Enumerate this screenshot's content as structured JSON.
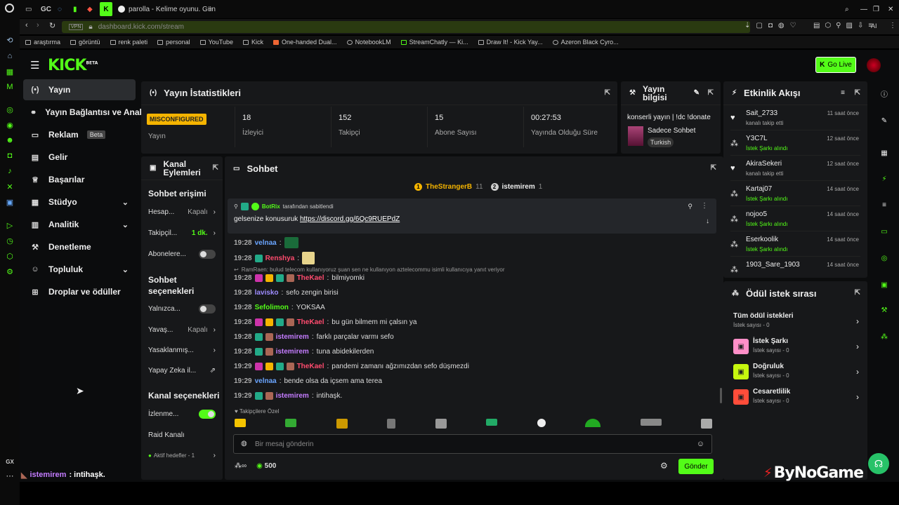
{
  "browser": {
    "tabs": [
      {
        "label": "GC"
      },
      {
        "label": "parolla - Kelime oyunu. Gün"
      }
    ],
    "new_tab": "+",
    "vpn": "VPN",
    "url": "dashboard.kick.com/stream",
    "ai": "AI",
    "bookmarks": [
      "araştırma",
      "görüntü",
      "renk paleti",
      "personal",
      "YouTube",
      "Kick",
      "One-handed Dual...",
      "NotebookLM",
      "StreamChatly — Ki...",
      "Draw It! - Kick Yay...",
      "Azeron Black Cyro..."
    ],
    "opera_gx": "GX"
  },
  "app": {
    "logo": "KICK",
    "logo_sup": "BETA",
    "go_live": "Go Live"
  },
  "nav": [
    {
      "label": "Yayın",
      "icon": "(•)",
      "active": true
    },
    {
      "label": "Yayın Bağlantısı ve Anahtar",
      "icon": "⚭"
    },
    {
      "label": "Reklam",
      "icon": "▭",
      "badge": "Beta"
    },
    {
      "label": "Gelir",
      "icon": "▤"
    },
    {
      "label": "Başarılar",
      "icon": "♕"
    },
    {
      "label": "Stüdyo",
      "icon": "▦",
      "chev": "⌄"
    },
    {
      "label": "Analitik",
      "icon": "▥",
      "chev": "⌄"
    },
    {
      "label": "Denetleme",
      "icon": "⚒"
    },
    {
      "label": "Topluluk",
      "icon": "☺",
      "chev": "⌄"
    },
    {
      "label": "Droplar ve ödüller",
      "icon": "⊞"
    }
  ],
  "stats": {
    "title": "Yayın İstatistikleri",
    "status_badge": "MISCONFIGURED",
    "status_label": "Yayın",
    "items": [
      {
        "value": "18",
        "label": "İzleyici"
      },
      {
        "value": "152",
        "label": "Takipçi"
      },
      {
        "value": "15",
        "label": "Abone Sayısı"
      },
      {
        "value": "00:27:53",
        "label": "Yayında Olduğu Süre"
      }
    ]
  },
  "info": {
    "title": "Yayın bilgisi",
    "stream_title": "konserli yayın | !dc !donate",
    "category": "Sadece Sohbet",
    "language": "Turkish"
  },
  "actions": {
    "title": "Kanal Eylemleri",
    "chat_access": "Sohbet erişimi",
    "rows1": [
      {
        "label": "Hesap...",
        "value": "Kapalı"
      },
      {
        "label": "Takipçil...",
        "value": "1 dk."
      },
      {
        "label": "Abonelere..."
      }
    ],
    "chat_options": "Sohbet seçenekleri",
    "rows2": [
      {
        "label": "Yalnızca..."
      },
      {
        "label": "Yavaş...",
        "value": "Kapalı"
      },
      {
        "label": "Yasaklanmış..."
      },
      {
        "label": "Yapay Zeka il..."
      }
    ],
    "channel_options": "Kanal seçenekleri",
    "rows3": [
      {
        "label": "İzlenme..."
      },
      {
        "label": "Raid Kanalı"
      },
      {
        "label": "Aktif hedefler - 1"
      }
    ]
  },
  "chat": {
    "title": "Sohbet",
    "top_chatters": [
      {
        "rank": "1",
        "name": "TheStrangerB",
        "count": "11"
      },
      {
        "rank": "2",
        "name": "istemirem",
        "count": "1"
      }
    ],
    "pinned_by": "BotRix",
    "pinned_suffix": "tarafından sabitlendi",
    "pinned_text": "gelsenize konusuruk",
    "pinned_link": "https://discord.gg/6Qc9RUEPdZ",
    "reply_note": "RamRaen: bulud telecom kullanıyoruz şuan sen ne kullanıyon aztelecommu isimli kullanıcıya yanıt veriyor",
    "messages": [
      {
        "time": "19:28",
        "user": "velnaa",
        "color": "#6aa5ff",
        "text": ""
      },
      {
        "time": "19:28",
        "user": "Renshya",
        "color": "#ff4b6e",
        "text": ""
      },
      {
        "time": "19:28",
        "user": "TheKael",
        "color": "#ff4b6e",
        "text": "bilmiyomki"
      },
      {
        "time": "19:28",
        "user": "lavisko",
        "color": "#9e8cff",
        "text": "sefo zengin birisi"
      },
      {
        "time": "19:28",
        "user": "Sefolimon",
        "color": "#53fc18",
        "text": "YOKSAA"
      },
      {
        "time": "19:28",
        "user": "TheKael",
        "color": "#ff4b6e",
        "text": "bu gün bilmem mi çalsın ya"
      },
      {
        "time": "19:28",
        "user": "istemirem",
        "color": "#c47cff",
        "text": "farklı parçalar varmı sefo"
      },
      {
        "time": "19:28",
        "user": "istemirem",
        "color": "#c47cff",
        "text": "tuna abidekilerden"
      },
      {
        "time": "19:29",
        "user": "TheKael",
        "color": "#ff4b6e",
        "text": "pandemi zamanı ağzımızdan sefo düşmezdi"
      },
      {
        "time": "19:29",
        "user": "velnaa",
        "color": "#6aa5ff",
        "text": "bende olsa da içsem ama terea"
      },
      {
        "time": "19:29",
        "user": "istemirem",
        "color": "#c47cff",
        "text": "intihaşk."
      }
    ],
    "followers_only": "Takipçilere Özel",
    "input_placeholder": "Bir mesaj gönderin",
    "points": "500",
    "send": "Gönder"
  },
  "events": {
    "title": "Etkinlik Akışı",
    "items": [
      {
        "icon": "♥",
        "name": "Sait_2733",
        "desc": "kanalı takip etti",
        "time": "11 saat önce"
      },
      {
        "icon": "⁂",
        "name": "Y3C7L",
        "desc": "İstek Şarkı alındı",
        "time": "12 saat önce"
      },
      {
        "icon": "♥",
        "name": "AkiraSekeri",
        "desc": "kanalı takip etti",
        "time": "12 saat önce"
      },
      {
        "icon": "⁂",
        "name": "Kartaj07",
        "desc": "İstek Şarkı alındı",
        "time": "14 saat önce"
      },
      {
        "icon": "⁂",
        "name": "nojoo5",
        "desc": "İstek Şarkı alındı",
        "time": "14 saat önce"
      },
      {
        "icon": "⁂",
        "name": "Eserkoolik",
        "desc": "İstek Şarkı alındı",
        "time": "14 saat önce"
      },
      {
        "icon": "⁂",
        "name": "1903_Sare_1903",
        "desc": "",
        "time": "14 saat önce"
      }
    ]
  },
  "rewards": {
    "title": "Ödül istek sırası",
    "items": [
      {
        "name": "Tüm ödül istekleri",
        "desc": "İstek sayısı - 0",
        "color": ""
      },
      {
        "name": "İstek Şarkı",
        "desc": "İstek sayısı - 0",
        "color": "#ff8fc8"
      },
      {
        "name": "Doğruluk",
        "desc": "İstek sayısı - 0",
        "color": "#c6f70e"
      },
      {
        "name": "Cesaretlilik",
        "desc": "İstek sayısı - 0",
        "color": "#ff4d3a"
      }
    ]
  },
  "overlay": {
    "chat_user": "istemirem",
    "chat_text": ": intihaşk.",
    "brand": "ByNoGame"
  }
}
